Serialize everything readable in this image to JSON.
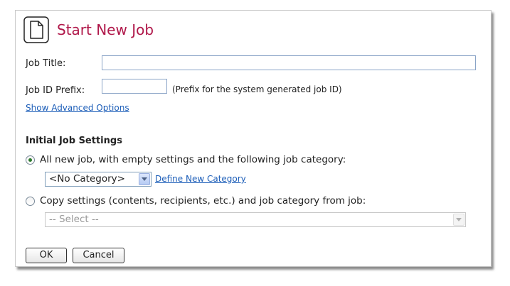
{
  "dialog": {
    "title": "Start New Job",
    "title_color": "#b0184a",
    "icon": "document-icon"
  },
  "form": {
    "job_title_label": "Job Title:",
    "job_title_value": "",
    "job_id_prefix_label": "Job ID Prefix:",
    "job_id_prefix_value": "",
    "job_id_prefix_hint": "(Prefix for the system generated job ID)",
    "advanced_link": "Show Advanced Options"
  },
  "settings": {
    "heading": "Initial Job Settings",
    "option_new": {
      "label": "All new job, with empty settings and the following job category:",
      "selected": true
    },
    "category_select": "<No Category>",
    "define_category_link": "Define New Category",
    "option_copy": {
      "label": "Copy settings (contents, recipients, etc.) and job category from job:",
      "selected": false
    },
    "copy_job_select": "-- Select --"
  },
  "buttons": {
    "ok": "OK",
    "cancel": "Cancel"
  },
  "colors": {
    "link": "#1b5db8",
    "radio_selected": "#2c7a2c"
  }
}
